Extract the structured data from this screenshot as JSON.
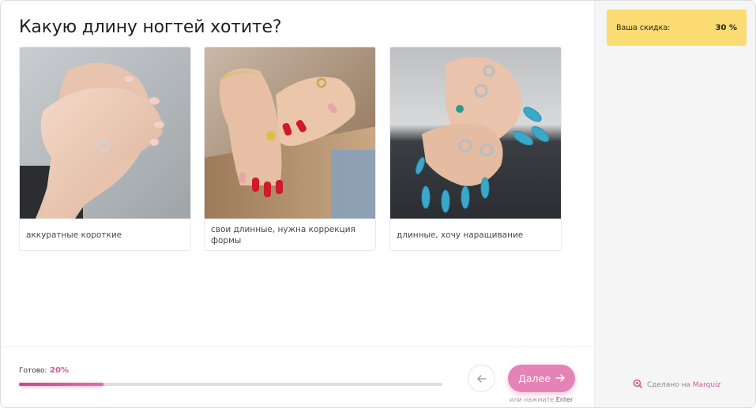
{
  "quiz": {
    "question": "Какую длину ногтей хотите?",
    "options": [
      {
        "label": "аккуратные короткие"
      },
      {
        "label": "свои длинные, нужна коррекция формы"
      },
      {
        "label": "длинные, хочу наращивание"
      }
    ]
  },
  "progress": {
    "label": "Готово:",
    "value_text": "20%",
    "fraction": 0.2
  },
  "navigation": {
    "next_label": "Далее",
    "hint_prefix": "или нажмите",
    "hint_key": "Enter"
  },
  "sidebar": {
    "discount_label": "Ваша скидка:",
    "discount_value": "30 %",
    "made_by_prefix": "Сделано на",
    "made_by_brand": "Marquiz"
  },
  "colors": {
    "accent": "#e683b6",
    "progress": "#d4569a",
    "discount_bg": "#fbdc72"
  }
}
